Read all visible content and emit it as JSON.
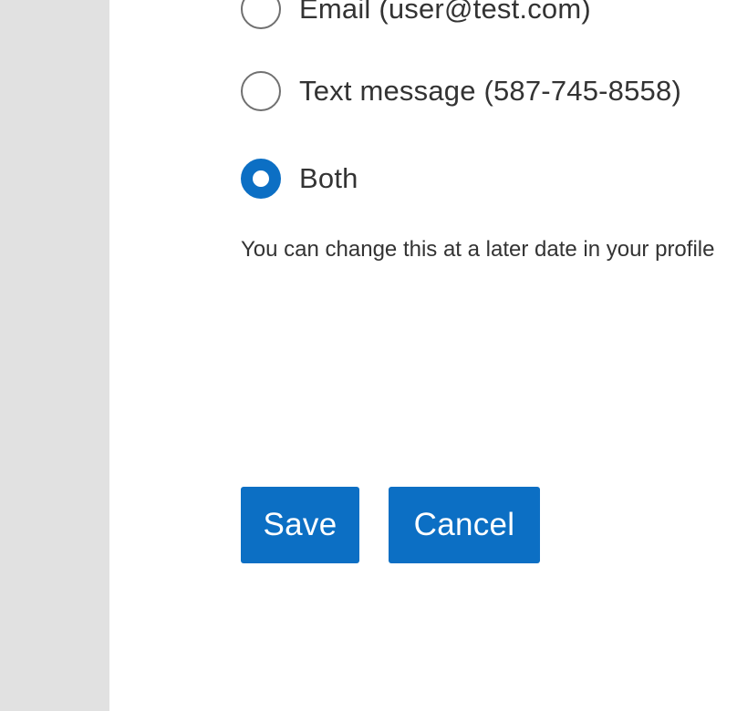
{
  "notification_preference": {
    "options": [
      {
        "label": "Email (user@test.com)",
        "selected": false
      },
      {
        "label": "Text message (587-745-8558)",
        "selected": false
      },
      {
        "label": "Both",
        "selected": true
      }
    ],
    "helper_text": "You can change this at a later date in your profile"
  },
  "actions": {
    "save_label": "Save",
    "cancel_label": "Cancel"
  },
  "colors": {
    "accent": "#0c6fc4",
    "sidebar_bg": "#e1e1e1",
    "text": "#333333",
    "radio_border": "#707070"
  }
}
